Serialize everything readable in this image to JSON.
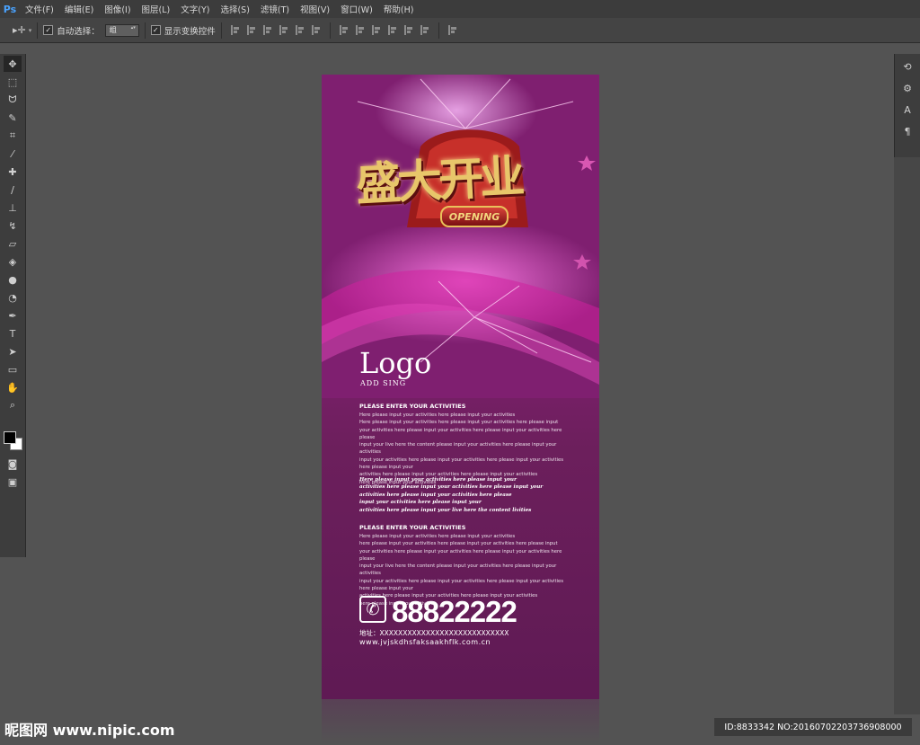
{
  "app": {
    "logo": "Ps"
  },
  "menu": [
    "文件(F)",
    "编辑(E)",
    "图像(I)",
    "图层(L)",
    "文字(Y)",
    "选择(S)",
    "滤镜(T)",
    "视图(V)",
    "窗口(W)",
    "帮助(H)"
  ],
  "options": {
    "auto_select_label": "自动选择：",
    "auto_select_value": "组",
    "show_transform_label": "显示变换控件"
  },
  "poster": {
    "title_cn": "盛大开业",
    "badge": "OPENING",
    "logo": "Logo",
    "logo_sub": "ADD SING",
    "heading1": "PLEASE ENTER YOUR ACTIVITIES",
    "para1": [
      "Here please input your activities here please input your activities",
      "Here please input your activities here please input your activities here please input",
      "your activities here please input your activities here please input your activities here please",
      "input your live here the content please input your activities here please input your activities",
      "input your activities here please input your activities here please input your activities here please input your",
      "activities here please input your activities here please input your activities",
      "here please input your activities"
    ],
    "italic": [
      "Here please input your activities here please input your",
      "activities here please input your activities here please input your",
      "activities here please input your activities here please",
      "input your activities here please input your",
      "activities here please input your live here the content livities"
    ],
    "heading2": "PLEASE ENTER YOUR ACTIVITIES",
    "para2": [
      "Here please input your activities here please input your activities",
      "here please input your activities here please input your activities here please input",
      "your activities here please input your activities here please input your activities here please",
      "input your live here the content please input your activities here please input your activities",
      "input your activities here please input your activities here please input your activities here please input your",
      "activities here please input your activities here please input your activities",
      "here please input your activities"
    ],
    "phone": "88822222",
    "address": "地址：XXXXXXXXXXXXXXXXXXXXXXXXXXXX",
    "website": "www.jvjskdhsfaksaakhflk.com.cn"
  },
  "watermark": "昵图网 www.nipic.com",
  "id_tag": "ID:8833342 NO:20160702203736908000"
}
